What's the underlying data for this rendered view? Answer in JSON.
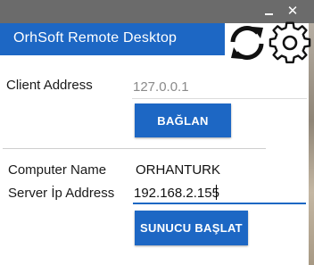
{
  "window": {
    "minimize_icon": "minimize-icon",
    "close_icon": "close-icon"
  },
  "header": {
    "title": "OrhSoft Remote Desktop",
    "accent_color": "#1d67c4"
  },
  "toolbar_icons": [
    "refresh-icon",
    "gear-icon"
  ],
  "client": {
    "label": "Client Address",
    "placeholder": "127.0.0.1",
    "connect_button": "BAĞLAN"
  },
  "server": {
    "computer_name_label": "Computer Name",
    "computer_name_value": "ORHANTURK",
    "ip_label": "Server İp Address",
    "ip_value": "192.168.2.155",
    "start_button": "SUNUCU BAŞLAT"
  }
}
